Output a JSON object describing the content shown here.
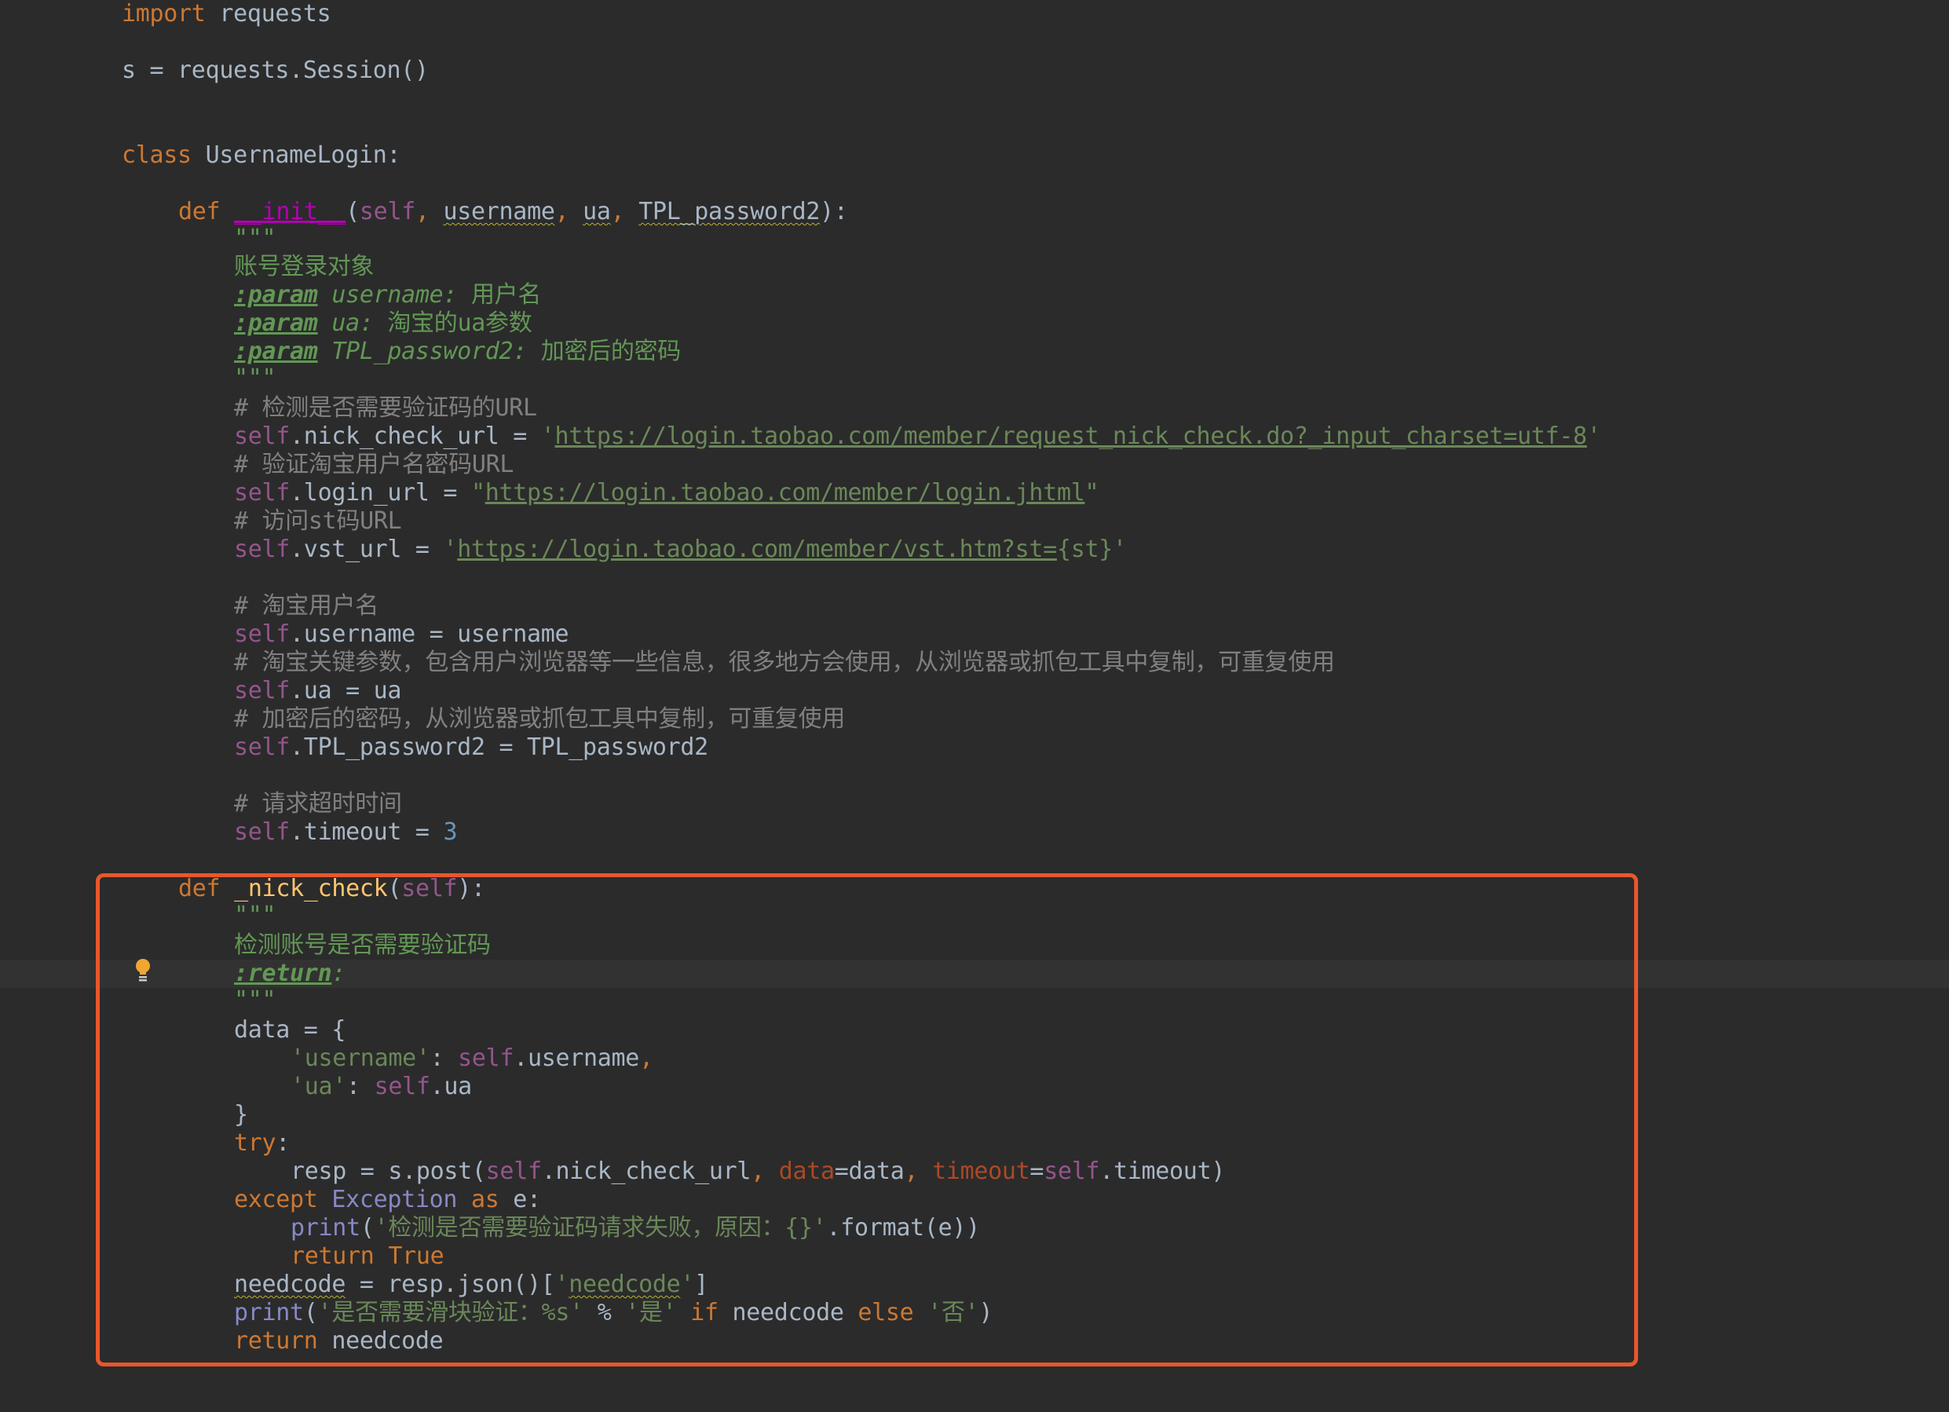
{
  "editor": {
    "language": "python",
    "highlight_color": "#e8572b",
    "lines": {
      "l1": {
        "kw": "import",
        "rest": " requests"
      },
      "l2": {
        "text": "s = requests.Session()"
      },
      "l3": {
        "kw": "class",
        "rest": " UsernameLogin:"
      },
      "l4": {
        "kw": "def",
        "name": "__init__",
        "open": "(",
        "self": "self",
        "c1": ", ",
        "p1": "username",
        "c2": ", ",
        "p2": "ua",
        "c3": ", ",
        "p3": "TPL_password2",
        "close": "):"
      },
      "l5": {
        "text": "\"\"\""
      },
      "l6": {
        "text": "账号登录对象"
      },
      "l7": {
        "tag": ":param",
        "rest": " username: ",
        "cn": "用户名"
      },
      "l8": {
        "tag": ":param",
        "rest": " ua: ",
        "cn": "淘宝的ua参数"
      },
      "l9": {
        "tag": ":param",
        "rest": " TPL_password2: ",
        "cn": "加密后的密码"
      },
      "l10": {
        "text": "\"\"\""
      },
      "l11": {
        "text": "# 检测是否需要验证码的URL"
      },
      "l12": {
        "self": "self",
        "attr": ".nick_check_url = ",
        "q1": "'",
        "url": "https://login.taobao.com/member/request_nick_check.do?_input_charset=utf-8",
        "q2": "'"
      },
      "l13": {
        "text": "# 验证淘宝用户名密码URL"
      },
      "l14": {
        "self": "self",
        "attr": ".login_url = ",
        "q1": "\"",
        "url": "https://login.taobao.com/member/login.jhtml",
        "q2": "\""
      },
      "l15": {
        "text": "# 访问st码URL"
      },
      "l16": {
        "self": "self",
        "attr": ".vst_url = ",
        "q1": "'",
        "url": "https://login.taobao.com/member/vst.htm?st=",
        "tail": "{st}'"
      },
      "l17": {
        "text": "# 淘宝用户名"
      },
      "l18": {
        "self": "self",
        "rest": ".username = username"
      },
      "l19": {
        "text": "# 淘宝关键参数，包含用户浏览器等一些信息，很多地方会使用，从浏览器或抓包工具中复制，可重复使用"
      },
      "l20": {
        "self": "self",
        "rest": ".ua = ua"
      },
      "l21": {
        "text": "# 加密后的密码，从浏览器或抓包工具中复制，可重复使用"
      },
      "l22": {
        "self": "self",
        "rest": ".TPL_password2 = TPL_password2"
      },
      "l23": {
        "text": "# 请求超时时间"
      },
      "l24": {
        "self": "self",
        "rest": ".timeout = ",
        "num": "3"
      },
      "l25": {
        "kw": "def",
        "name": "_nick_check",
        "open": "(",
        "self": "self",
        "close": "):"
      },
      "l26": {
        "text": "\"\"\""
      },
      "l27": {
        "text": "检测账号是否需要验证码"
      },
      "l28": {
        "tag": ":return",
        "rest": ":"
      },
      "l29": {
        "text": "\"\"\""
      },
      "l30": {
        "text": "data = {"
      },
      "l31": {
        "str": "'username'",
        "rest": ": ",
        "self": "self",
        "attr": ".username",
        "comma": ","
      },
      "l32": {
        "str": "'ua'",
        "rest": ": ",
        "self": "self",
        "attr": ".ua"
      },
      "l33": {
        "text": "}"
      },
      "l34": {
        "kw": "try",
        "rest": ":"
      },
      "l35": {
        "a": "resp = s.post(",
        "self1": "self",
        "b": ".nick_check_url",
        "c1": ", ",
        "k1": "data",
        "d": "=data",
        "c2": ", ",
        "k2": "timeout",
        "e": "=",
        "self2": "self",
        "f": ".timeout)"
      },
      "l36": {
        "kw": "except",
        "sp": " ",
        "cls": "Exception",
        "sp2": " ",
        "kw2": "as",
        "rest": " e:"
      },
      "l37": {
        "fn": "print",
        "open": "(",
        "str": "'检测是否需要验证码请求失败，原因：{}'",
        "rest": ".format(e))"
      },
      "l38": {
        "kw": "return True"
      },
      "l39": {
        "var": "needcode",
        "a": " = resp.json()[",
        "str1": "'",
        "str": "needcode",
        "str2": "'",
        "b": "]"
      },
      "l40": {
        "fn": "print",
        "open": "(",
        "str": "'是否需要滑块验证：%s'",
        "a": " % ",
        "str2": "'是'",
        "sp": " ",
        "kw": "if",
        "b": " needcode ",
        "kw2": "else",
        "sp2": " ",
        "str3": "'否'",
        "close": ")"
      },
      "l41": {
        "kw": "return",
        "rest": " needcode"
      }
    }
  }
}
